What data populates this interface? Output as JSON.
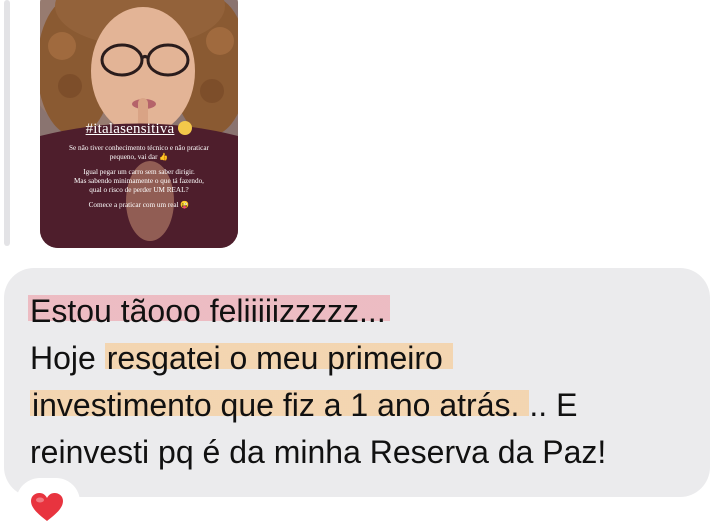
{
  "story": {
    "hashtag": "#italasensitiva",
    "line1": "Se não tiver conhecimento técnico e não praticar",
    "line2": "pequeno, vai dar 👍",
    "line3": "Igual pegar um carro sem saber dirigir.",
    "line4": "Mas sabendo minimamente o que tá fazendo,",
    "line5": "qual o risco de perder UM REAL?",
    "line6": "Comece a praticar com um real 😜"
  },
  "message": {
    "line1_highlight": "Estou tãooo feliiiiizzzzz...",
    "line2_prefix": "Hoje ",
    "line2_highlight": "resgatei o meu primeiro",
    "line3_highlight": "investimento que fiz a 1 ano atrás.",
    "line3_suffix": ".. E",
    "line4": "reinvesti pq é da minha Reserva da Paz!"
  },
  "reaction": {
    "icon": "heart-icon"
  },
  "colors": {
    "bubble": "#ebebed",
    "highlight_pink": "#ee96a0",
    "highlight_orange": "#f8c88c",
    "heart": "#e8343f"
  }
}
